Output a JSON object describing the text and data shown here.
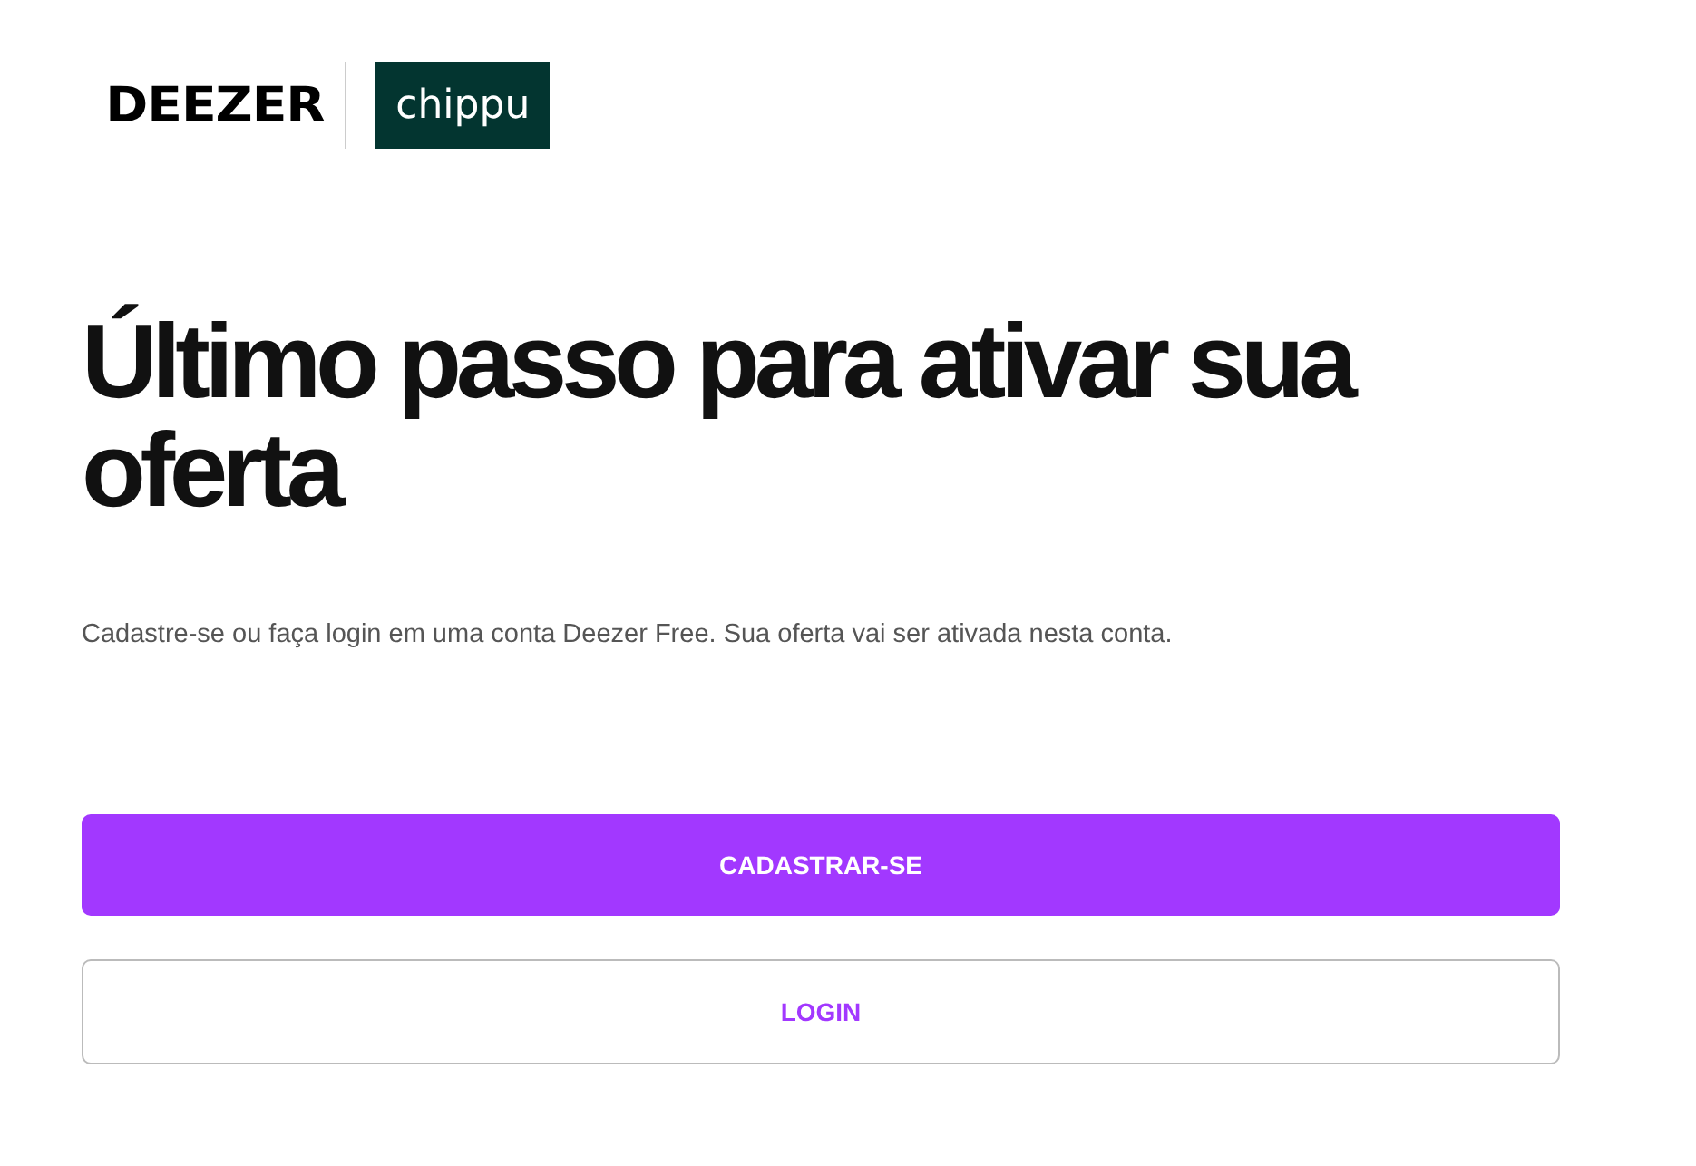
{
  "header": {
    "brand": "DEEZER",
    "partner": "chippu"
  },
  "title": "Último passo para ativar sua oferta",
  "description": "Cadastre-se ou faça login em uma conta Deezer Free. Sua oferta vai ser ativada nesta conta.",
  "buttons": [
    {
      "label": "CADASTRAR-SE",
      "kind": "primary"
    },
    {
      "label": "LOGIN",
      "kind": "secondary"
    }
  ]
}
